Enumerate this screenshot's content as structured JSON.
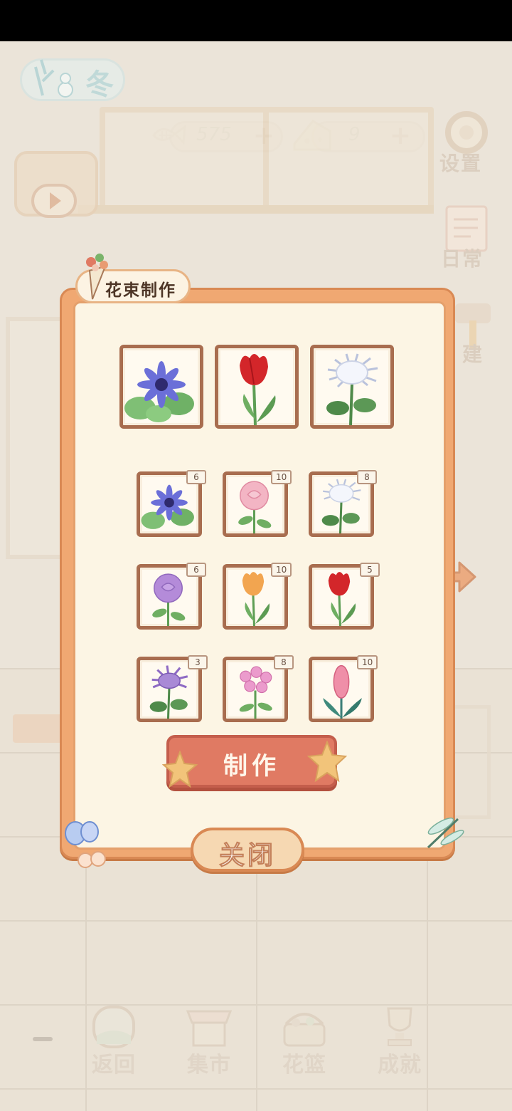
{
  "hud": {
    "season": "冬",
    "fish_count": "575",
    "cheese_count": "9",
    "plus": "+"
  },
  "side_menu": {
    "settings": "设置",
    "daily": "日常",
    "build": "建"
  },
  "modal": {
    "title": "花束制作",
    "make_label": "制作",
    "close_label": "关闭",
    "selected_slots": [
      {
        "flower": "blue-daisy"
      },
      {
        "flower": "red-tulip"
      },
      {
        "flower": "white-chrysanthemum"
      }
    ],
    "inventory": [
      {
        "flower": "blue-daisy",
        "count": "6"
      },
      {
        "flower": "pink-rose",
        "count": "10"
      },
      {
        "flower": "white-chrysanthemum",
        "count": "8"
      },
      {
        "flower": "purple-rose",
        "count": "6"
      },
      {
        "flower": "orange-tulip",
        "count": "10"
      },
      {
        "flower": "red-tulip",
        "count": "5"
      },
      {
        "flower": "purple-chrysanthemum",
        "count": "3"
      },
      {
        "flower": "pink-phlox",
        "count": "8"
      },
      {
        "flower": "pink-hyacinth",
        "count": "10"
      }
    ]
  },
  "bottom_nav": {
    "back": "返回",
    "market": "集市",
    "basket": "花篮",
    "achievements": "成就"
  },
  "colors": {
    "modal_frame": "#f0a872",
    "modal_inner": "#fcf5e4",
    "card_border": "#a86d4f",
    "make_button": "#e07a63"
  }
}
